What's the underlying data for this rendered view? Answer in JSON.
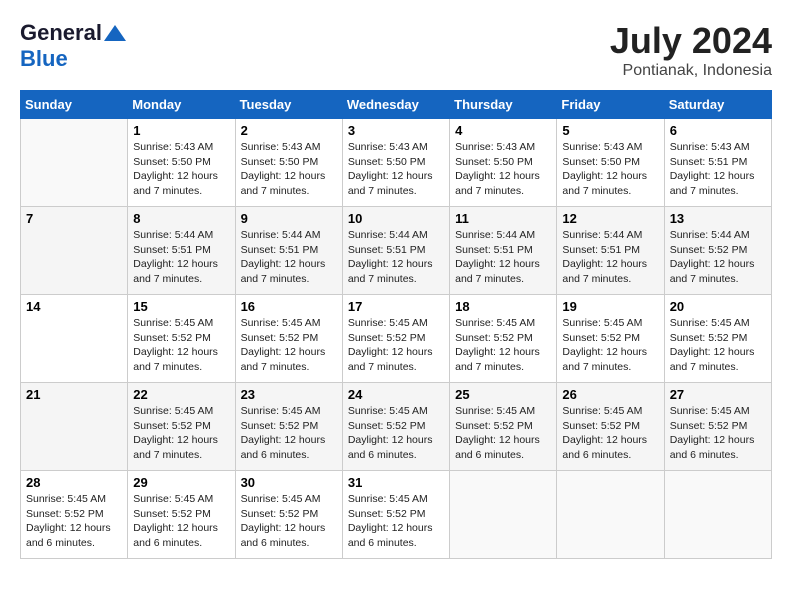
{
  "header": {
    "logo_general": "General",
    "logo_blue": "Blue",
    "title": "July 2024",
    "location": "Pontianak, Indonesia"
  },
  "weekdays": [
    "Sunday",
    "Monday",
    "Tuesday",
    "Wednesday",
    "Thursday",
    "Friday",
    "Saturday"
  ],
  "weeks": [
    [
      {
        "day": "",
        "info": ""
      },
      {
        "day": "1",
        "info": "Sunrise: 5:43 AM\nSunset: 5:50 PM\nDaylight: 12 hours\nand 7 minutes."
      },
      {
        "day": "2",
        "info": "Sunrise: 5:43 AM\nSunset: 5:50 PM\nDaylight: 12 hours\nand 7 minutes."
      },
      {
        "day": "3",
        "info": "Sunrise: 5:43 AM\nSunset: 5:50 PM\nDaylight: 12 hours\nand 7 minutes."
      },
      {
        "day": "4",
        "info": "Sunrise: 5:43 AM\nSunset: 5:50 PM\nDaylight: 12 hours\nand 7 minutes."
      },
      {
        "day": "5",
        "info": "Sunrise: 5:43 AM\nSunset: 5:50 PM\nDaylight: 12 hours\nand 7 minutes."
      },
      {
        "day": "6",
        "info": "Sunrise: 5:43 AM\nSunset: 5:51 PM\nDaylight: 12 hours\nand 7 minutes."
      }
    ],
    [
      {
        "day": "7",
        "info": ""
      },
      {
        "day": "8",
        "info": "Sunrise: 5:44 AM\nSunset: 5:51 PM\nDaylight: 12 hours\nand 7 minutes."
      },
      {
        "day": "9",
        "info": "Sunrise: 5:44 AM\nSunset: 5:51 PM\nDaylight: 12 hours\nand 7 minutes."
      },
      {
        "day": "10",
        "info": "Sunrise: 5:44 AM\nSunset: 5:51 PM\nDaylight: 12 hours\nand 7 minutes."
      },
      {
        "day": "11",
        "info": "Sunrise: 5:44 AM\nSunset: 5:51 PM\nDaylight: 12 hours\nand 7 minutes."
      },
      {
        "day": "12",
        "info": "Sunrise: 5:44 AM\nSunset: 5:51 PM\nDaylight: 12 hours\nand 7 minutes."
      },
      {
        "day": "13",
        "info": "Sunrise: 5:44 AM\nSunset: 5:52 PM\nDaylight: 12 hours\nand 7 minutes."
      }
    ],
    [
      {
        "day": "14",
        "info": ""
      },
      {
        "day": "15",
        "info": "Sunrise: 5:45 AM\nSunset: 5:52 PM\nDaylight: 12 hours\nand 7 minutes."
      },
      {
        "day": "16",
        "info": "Sunrise: 5:45 AM\nSunset: 5:52 PM\nDaylight: 12 hours\nand 7 minutes."
      },
      {
        "day": "17",
        "info": "Sunrise: 5:45 AM\nSunset: 5:52 PM\nDaylight: 12 hours\nand 7 minutes."
      },
      {
        "day": "18",
        "info": "Sunrise: 5:45 AM\nSunset: 5:52 PM\nDaylight: 12 hours\nand 7 minutes."
      },
      {
        "day": "19",
        "info": "Sunrise: 5:45 AM\nSunset: 5:52 PM\nDaylight: 12 hours\nand 7 minutes."
      },
      {
        "day": "20",
        "info": "Sunrise: 5:45 AM\nSunset: 5:52 PM\nDaylight: 12 hours\nand 7 minutes."
      }
    ],
    [
      {
        "day": "21",
        "info": ""
      },
      {
        "day": "22",
        "info": "Sunrise: 5:45 AM\nSunset: 5:52 PM\nDaylight: 12 hours\nand 7 minutes."
      },
      {
        "day": "23",
        "info": "Sunrise: 5:45 AM\nSunset: 5:52 PM\nDaylight: 12 hours\nand 6 minutes."
      },
      {
        "day": "24",
        "info": "Sunrise: 5:45 AM\nSunset: 5:52 PM\nDaylight: 12 hours\nand 6 minutes."
      },
      {
        "day": "25",
        "info": "Sunrise: 5:45 AM\nSunset: 5:52 PM\nDaylight: 12 hours\nand 6 minutes."
      },
      {
        "day": "26",
        "info": "Sunrise: 5:45 AM\nSunset: 5:52 PM\nDaylight: 12 hours\nand 6 minutes."
      },
      {
        "day": "27",
        "info": "Sunrise: 5:45 AM\nSunset: 5:52 PM\nDaylight: 12 hours\nand 6 minutes."
      }
    ],
    [
      {
        "day": "28",
        "info": "Sunrise: 5:45 AM\nSunset: 5:52 PM\nDaylight: 12 hours\nand 6 minutes."
      },
      {
        "day": "29",
        "info": "Sunrise: 5:45 AM\nSunset: 5:52 PM\nDaylight: 12 hours\nand 6 minutes."
      },
      {
        "day": "30",
        "info": "Sunrise: 5:45 AM\nSunset: 5:52 PM\nDaylight: 12 hours\nand 6 minutes."
      },
      {
        "day": "31",
        "info": "Sunrise: 5:45 AM\nSunset: 5:52 PM\nDaylight: 12 hours\nand 6 minutes."
      },
      {
        "day": "",
        "info": ""
      },
      {
        "day": "",
        "info": ""
      },
      {
        "day": "",
        "info": ""
      }
    ]
  ]
}
